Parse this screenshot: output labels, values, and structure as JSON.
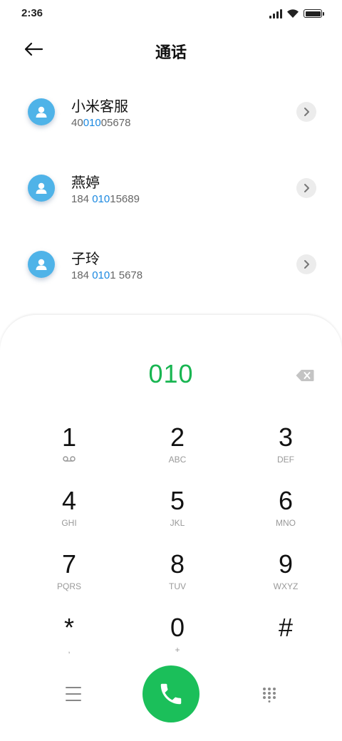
{
  "status_bar": {
    "time": "2:36"
  },
  "header": {
    "title": "通话",
    "back_icon": "arrow-left-icon"
  },
  "contacts": [
    {
      "name": "小米客服",
      "number_parts": [
        "40",
        "010",
        "05678"
      ]
    },
    {
      "name": "燕婷",
      "number_parts": [
        "184 ",
        "010",
        "15689"
      ]
    },
    {
      "name": "子玲",
      "number_parts": [
        "184 ",
        "010",
        "1 5678"
      ]
    }
  ],
  "dialer": {
    "dialed_number": "010",
    "keys": [
      {
        "digit": "1",
        "letters": ""
      },
      {
        "digit": "2",
        "letters": "ABC"
      },
      {
        "digit": "3",
        "letters": "DEF"
      },
      {
        "digit": "4",
        "letters": "GHI"
      },
      {
        "digit": "5",
        "letters": "JKL"
      },
      {
        "digit": "6",
        "letters": "MNO"
      },
      {
        "digit": "7",
        "letters": "PQRS"
      },
      {
        "digit": "8",
        "letters": "TUV"
      },
      {
        "digit": "9",
        "letters": "WXYZ"
      },
      {
        "digit": "*",
        "letters": ","
      },
      {
        "digit": "0",
        "letters": "+"
      },
      {
        "digit": "#",
        "letters": ""
      }
    ]
  },
  "colors": {
    "accent_green": "#1bbf5a",
    "number_highlight": "#1a88e0",
    "avatar_blue": "#4fb3e8"
  },
  "icons": [
    "voicemail-icon",
    "backspace-icon",
    "phone-icon",
    "menu-icon",
    "dialpad-icon",
    "chevron-right-icon",
    "person-icon"
  ]
}
